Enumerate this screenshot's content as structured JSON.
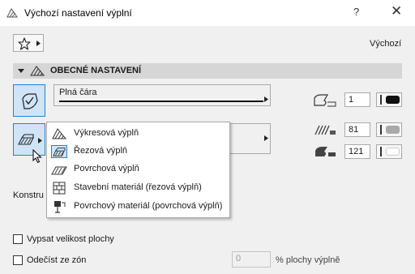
{
  "window": {
    "title": "Výchozí nastavení výplní",
    "help_glyph": "?",
    "close_glyph": "✕"
  },
  "toolbar": {
    "favorites_icon": "star-icon",
    "defaults_label": "Výchozí"
  },
  "section": {
    "label": "OBECNÉ NASTAVENÍ"
  },
  "fill_type": {
    "line_label": "Plná čára"
  },
  "pens": {
    "outline_pen": "1",
    "foreground_pen": "81",
    "background_pen": "121"
  },
  "colors": {
    "outline": "#111111",
    "foreground": "#a8a8a8",
    "background": "#ffffff",
    "selection": "#cfe4f7",
    "accent": "#2f7fc8"
  },
  "construct_label": "Konstru",
  "options": {
    "show_area_label": "Vypsat velikost plochy",
    "subtract_label": "Odečíst ze zón",
    "percent_value": "0",
    "percent_suffix": "% plochy výplně"
  },
  "popup": {
    "items": [
      {
        "label": "Výkresová výplň",
        "icon": "drafting-fill-icon",
        "selected": false
      },
      {
        "label": "Řezová výplň",
        "icon": "cut-fill-icon",
        "selected": true
      },
      {
        "label": "Povrchová výplň",
        "icon": "cover-fill-icon",
        "selected": false
      },
      {
        "label": "Stavební materiál (řezová výplň)",
        "icon": "building-material-icon",
        "selected": false
      },
      {
        "label": "Povrchový materiál (povrchová výplň)",
        "icon": "surface-material-icon",
        "selected": false
      }
    ]
  }
}
